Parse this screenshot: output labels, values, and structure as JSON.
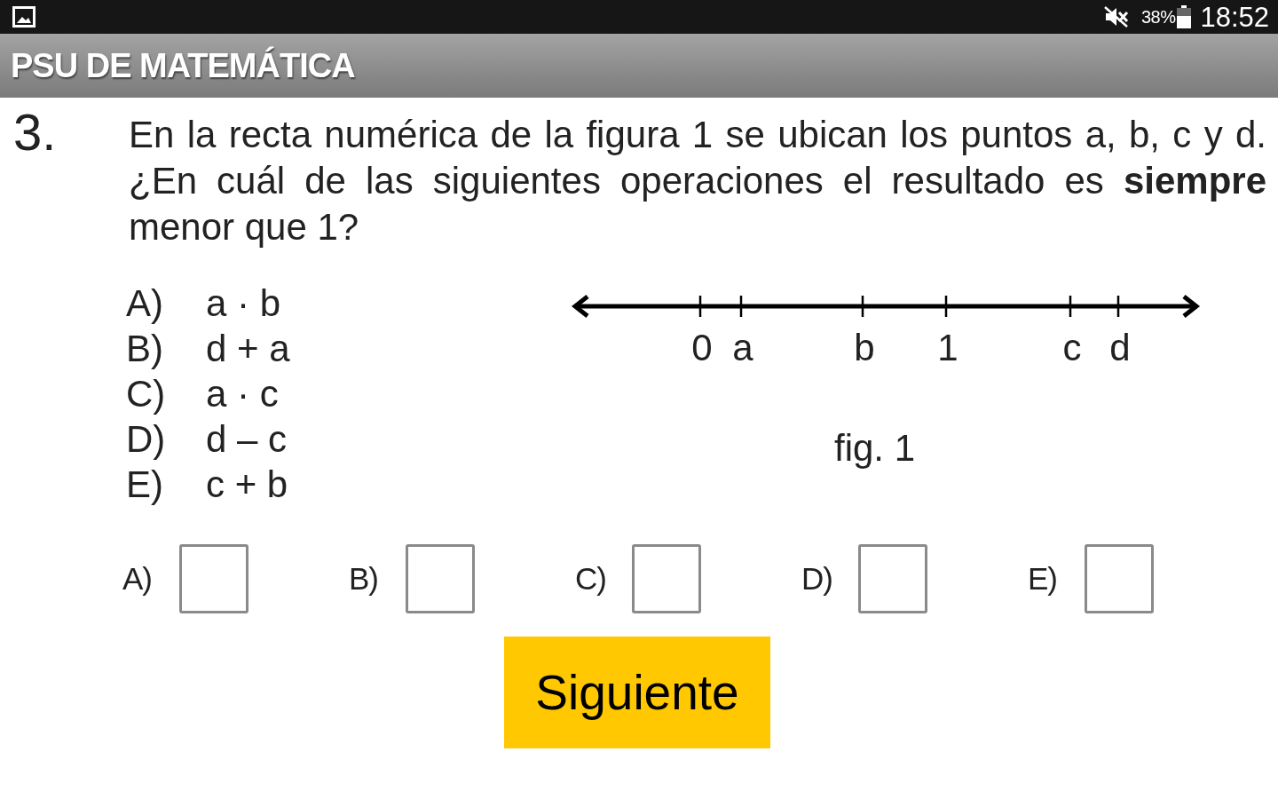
{
  "status_bar": {
    "battery": "38%",
    "time": "18:52"
  },
  "app_bar": {
    "title": "PSU DE MATEMÁTICA"
  },
  "question": {
    "number": "3.",
    "text": "En la recta numérica de la figura 1 se ubican los puntos a, b, c y d. ¿En cuál de las siguientes operaciones el resultado es **siempre** menor que 1?",
    "options": [
      {
        "letter": "A)",
        "expression": "a · b"
      },
      {
        "letter": "B)",
        "expression": "d + a"
      },
      {
        "letter": "C)",
        "expression": "a · c"
      },
      {
        "letter": "D)",
        "expression": "d – c"
      },
      {
        "letter": "E)",
        "expression": "c + b"
      }
    ],
    "figure": {
      "points": [
        {
          "label": "0"
        },
        {
          "label": "a"
        },
        {
          "label": "b"
        },
        {
          "label": "1"
        },
        {
          "label": "c"
        },
        {
          "label": "d"
        }
      ],
      "caption": "fig. 1"
    }
  },
  "answers": [
    {
      "label": "A)",
      "checked": false
    },
    {
      "label": "B)",
      "checked": false
    },
    {
      "label": "C)",
      "checked": false
    },
    {
      "label": "D)",
      "checked": false
    },
    {
      "label": "E)",
      "checked": false
    }
  ],
  "next_button": {
    "label": "Siguiente"
  }
}
